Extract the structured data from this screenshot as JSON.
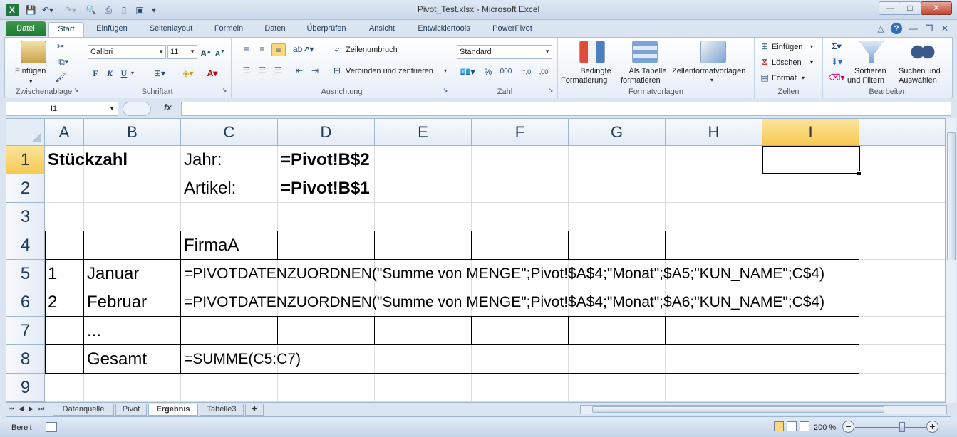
{
  "window": {
    "title": "Pivot_Test.xlsx  -  Microsoft Excel",
    "app_icon": "X",
    "controls": {
      "minimize": "—",
      "maximize": "□",
      "close": "✕"
    }
  },
  "ribbon_tabs": [
    "Datei",
    "Start",
    "Einfügen",
    "Seitenlayout",
    "Formeln",
    "Daten",
    "Überprüfen",
    "Ansicht",
    "Entwicklertools",
    "PowerPivot"
  ],
  "ribbon": {
    "clipboard": {
      "paste": "Einfügen",
      "label": "Zwischenablage"
    },
    "font": {
      "name": "Calibri",
      "size": "11",
      "bold": "F",
      "italic": "K",
      "underline": "U",
      "label": "Schriftart"
    },
    "alignment": {
      "wrap": "Zeilenumbruch",
      "merge": "Verbinden und zentrieren",
      "label": "Ausrichtung"
    },
    "number": {
      "format": "Standard",
      "label": "Zahl"
    },
    "styles": {
      "conditional": "Bedingte",
      "conditional2": "Formatierung",
      "table": "Als Tabelle",
      "table2": "formatieren",
      "cellstyles": "Zellenformatvorlagen",
      "label": "Formatvorlagen"
    },
    "cells": {
      "insert": "Einfügen",
      "delete": "Löschen",
      "format": "Format",
      "label": "Zellen"
    },
    "editing": {
      "sum": "Σ",
      "sort": "Sortieren",
      "sort2": "und Filtern",
      "find": "Suchen und",
      "find2": "Auswählen",
      "label": "Bearbeiten"
    }
  },
  "formula_bar": {
    "name_box": "I1",
    "fx": "fx",
    "value": ""
  },
  "columns": [
    "A",
    "B",
    "C",
    "D",
    "E",
    "F",
    "G",
    "H",
    "I"
  ],
  "rows": [
    "1",
    "2",
    "3",
    "4",
    "5",
    "6",
    "7",
    "8",
    "9"
  ],
  "cells": {
    "A1": "Stückzahl",
    "C1": "Jahr:",
    "D1": "=Pivot!B$2",
    "C2": "Artikel:",
    "D2": "=Pivot!B$1",
    "C4": "FirmaA",
    "A5": "1",
    "B5": "Januar",
    "C5": "=PIVOTDATENZUORDNEN(\"Summe von MENGE\";Pivot!$A$4;\"Monat\";$A5;\"KUN_NAME\";C$4)",
    "A6": "2",
    "B6": "Februar",
    "C6": "=PIVOTDATENZUORDNEN(\"Summe von MENGE\";Pivot!$A$4;\"Monat\";$A6;\"KUN_NAME\";C$4)",
    "B7": "...",
    "B8": "Gesamt",
    "C8": "=SUMME(C5:C7)"
  },
  "sheets": [
    "Datenquelle",
    "Pivot",
    "Ergebnis",
    "Tabelle3"
  ],
  "active_sheet": "Ergebnis",
  "status": {
    "mode": "Bereit",
    "zoom": "200 %"
  }
}
